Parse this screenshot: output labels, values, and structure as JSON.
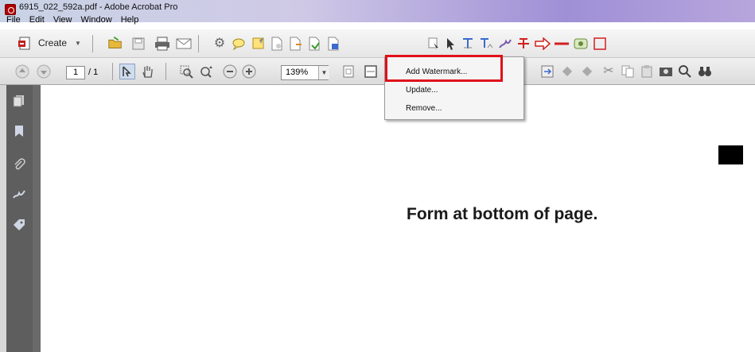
{
  "window": {
    "title": "6915_022_592a.pdf - Adobe Acrobat Pro"
  },
  "menubar": {
    "items": [
      "File",
      "Edit",
      "View",
      "Window",
      "Help"
    ]
  },
  "toolbar1": {
    "create_label": "Create",
    "icons": [
      "create-pdf-icon",
      "open-folder-icon",
      "save-icon",
      "print-icon",
      "email-icon",
      "settings-gear-icon",
      "comment-icon",
      "sticky-note-icon",
      "document-icon",
      "document-arrow-icon",
      "document-export-icon",
      "watermark-icon",
      "select-object-icon",
      "cursor-icon",
      "text-edit-icon",
      "text-touchup-icon",
      "sign-pen-icon",
      "strikethrough-icon",
      "arrow-icon",
      "line-icon",
      "stamp-icon",
      "rectangle-icon"
    ]
  },
  "toolbar2": {
    "page_current": "1",
    "page_total": "/ 1",
    "zoom": "139%",
    "icons": [
      "prev-page-icon",
      "next-page-icon",
      "select-tool-icon",
      "hand-tool-icon",
      "zoom-marquee-icon",
      "zoom-dynamic-icon",
      "zoom-out-icon",
      "zoom-in-icon",
      "fit-page-icon",
      "fit-width-icon",
      "export-icon",
      "undo-icon",
      "redo-icon",
      "cut-icon",
      "copy-icon",
      "paste-icon",
      "snapshot-icon",
      "search-icon",
      "binoculars-icon"
    ]
  },
  "watermark_menu": {
    "items": [
      {
        "label": "Add Watermark...",
        "accel": "A"
      },
      {
        "label": "Update...",
        "accel": "U"
      },
      {
        "label": "Remove...",
        "accel": "R"
      }
    ]
  },
  "left_panel": {
    "icons": [
      "pages-icon",
      "bookmarks-icon",
      "attachments-icon",
      "signatures-icon",
      "tags-icon"
    ]
  },
  "document": {
    "text": "Form at bottom of page."
  },
  "colors": {
    "highlight": "#e0101a",
    "left_panel": "#5e5e5e"
  }
}
